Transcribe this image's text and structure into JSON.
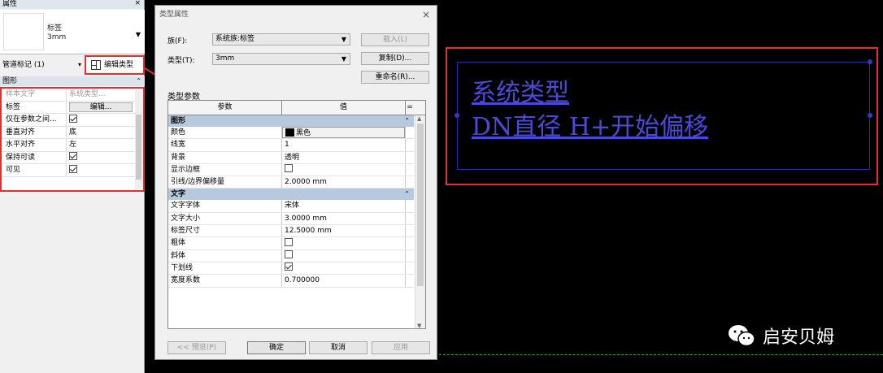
{
  "properties_panel": {
    "title": "属性",
    "close": "×",
    "type_selector": {
      "name_line1": "标签",
      "name_line2": "3mm"
    },
    "instance_filter": "管道标记 (1)",
    "edit_type_label": "编辑类型",
    "group_graphics": "图形",
    "rows": [
      {
        "key": "样本文字",
        "value": "系统类型..."
      },
      {
        "key": "标签",
        "button": "编辑..."
      },
      {
        "key": "仅在参数之间...",
        "checked": true
      },
      {
        "key": "垂直对齐",
        "value": "底"
      },
      {
        "key": "水平对齐",
        "value": "左"
      },
      {
        "key": "保持可读",
        "checked": true
      },
      {
        "key": "可见",
        "checked": true
      }
    ]
  },
  "dialog": {
    "title": "类型属性",
    "close": "×",
    "family_label": "族(F):",
    "family_value": "系统族:标签",
    "type_label": "类型(T):",
    "type_value": "3mm",
    "load_btn": "载入(L)",
    "duplicate_btn": "复制(D)...",
    "rename_btn": "重命名(R)...",
    "section_title": "类型参数",
    "col_param": "参数",
    "col_value": "值",
    "col_eq": "=",
    "groups": [
      {
        "name": "图形",
        "rows": [
          {
            "key": "颜色",
            "value": "黑色",
            "color": "#000000"
          },
          {
            "key": "线宽",
            "value": "1"
          },
          {
            "key": "背景",
            "value": "透明"
          },
          {
            "key": "显示边框",
            "checked": false
          },
          {
            "key": "引线/边界偏移量",
            "value": "2.0000 mm"
          }
        ]
      },
      {
        "name": "文字",
        "rows": [
          {
            "key": "文字字体",
            "value": "宋体"
          },
          {
            "key": "文字大小",
            "value": "3.0000 mm"
          },
          {
            "key": "标签尺寸",
            "value": "12.5000 mm"
          },
          {
            "key": "粗体",
            "checked": false
          },
          {
            "key": "斜体",
            "checked": false
          },
          {
            "key": "下划线",
            "checked": true
          },
          {
            "key": "宽度系数",
            "value": "0.700000"
          }
        ]
      }
    ],
    "preview_btn": "<< 预览(P)",
    "ok_btn": "确定",
    "cancel_btn": "取消",
    "apply_btn": "应用"
  },
  "canvas": {
    "tag_line1": "系统类型",
    "tag_line2": "DN直径 H+开始偏移",
    "tag_color": "#4a4ad8"
  },
  "watermark": {
    "text": "启安贝姆",
    "icon": "wechat-icon"
  },
  "colors": {
    "highlight": "#e03030",
    "group_header": "#b7c9de"
  }
}
